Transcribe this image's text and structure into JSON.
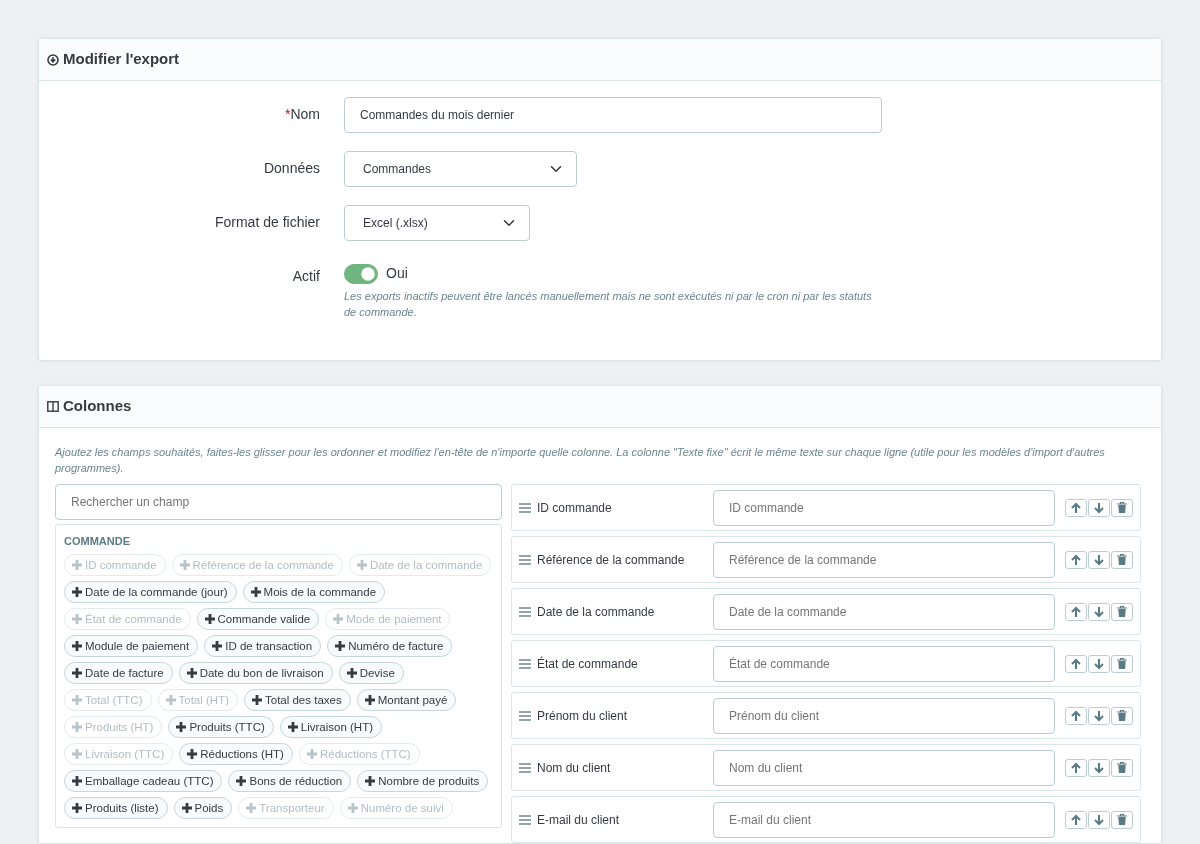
{
  "export_card": {
    "title": "Modifier l'export",
    "fields": [
      {
        "kind": "text",
        "required_mark": "*",
        "label": "Nom",
        "value": "Commandes du mois dernier"
      },
      {
        "kind": "select",
        "label": "Données",
        "value": "Commandes"
      },
      {
        "kind": "select",
        "label": "Format de fichier",
        "value": "Excel (.xlsx)"
      },
      {
        "kind": "switch",
        "label": "Actif",
        "on": true,
        "text": "Oui",
        "help": "Les exports inactifs peuvent être lancés manuellement mais ne sont exécutés ni par le cron ni par les statuts de commande."
      }
    ]
  },
  "columns_card": {
    "title": "Colonnes",
    "description": "Ajoutez les champs souhaités, faites-les glisser pour les ordonner et modifiez l'en-tête de n'importe quelle colonne. La colonne \"Texte fixe\" écrit le même texte sur chaque ligne (utile pour les modèles d'import d'autres programmes).",
    "search": {
      "placeholder": "Rechercher un champ"
    },
    "group": {
      "title": "COMMANDE",
      "fields": [
        {
          "label": "ID commande",
          "disabled": true
        },
        {
          "label": "Référence de la commande",
          "disabled": true
        },
        {
          "label": "Date de la commande",
          "disabled": true
        },
        {
          "label": "Date de la commande (jour)",
          "disabled": false
        },
        {
          "label": "Mois de la commande",
          "disabled": false
        },
        {
          "label": "État de commande",
          "disabled": true
        },
        {
          "label": "Commande valide",
          "disabled": false
        },
        {
          "label": "Mode de paiement",
          "disabled": true
        },
        {
          "label": "Module de paiement",
          "disabled": false
        },
        {
          "label": "ID de transaction",
          "disabled": false
        },
        {
          "label": "Numéro de facture",
          "disabled": false
        },
        {
          "label": "Date de facture",
          "disabled": false
        },
        {
          "label": "Date du bon de livraison",
          "disabled": false
        },
        {
          "label": "Devise",
          "disabled": false
        },
        {
          "label": "Total (TTC)",
          "disabled": true
        },
        {
          "label": "Total (HT)",
          "disabled": true
        },
        {
          "label": "Total des taxes",
          "disabled": false
        },
        {
          "label": "Montant payé",
          "disabled": false
        },
        {
          "label": "Produits (HT)",
          "disabled": true
        },
        {
          "label": "Produits (TTC)",
          "disabled": false
        },
        {
          "label": "Livraison (HT)",
          "disabled": false
        },
        {
          "label": "Livraison (TTC)",
          "disabled": true
        },
        {
          "label": "Réductions (HT)",
          "disabled": false
        },
        {
          "label": "Réductions (TTC)",
          "disabled": true
        },
        {
          "label": "Emballage cadeau (TTC)",
          "disabled": false
        },
        {
          "label": "Bons de réduction",
          "disabled": false
        },
        {
          "label": "Nombre de produits",
          "disabled": false
        },
        {
          "label": "Produits (liste)",
          "disabled": false
        },
        {
          "label": "Poids",
          "disabled": false
        },
        {
          "label": "Transporteur",
          "disabled": true
        },
        {
          "label": "Numéro de suivi",
          "disabled": true
        }
      ]
    },
    "columns": [
      {
        "label": "ID commande",
        "placeholder": "ID commande"
      },
      {
        "label": "Référence de la commande",
        "placeholder": "Référence de la commande"
      },
      {
        "label": "Date de la commande",
        "placeholder": "Date de la commande"
      },
      {
        "label": "État de commande",
        "placeholder": "État de commande"
      },
      {
        "label": "Prénom du client",
        "placeholder": "Prénom du client"
      },
      {
        "label": "Nom du client",
        "placeholder": "Nom du client"
      },
      {
        "label": "E-mail du client",
        "placeholder": "E-mail du client"
      }
    ]
  }
}
